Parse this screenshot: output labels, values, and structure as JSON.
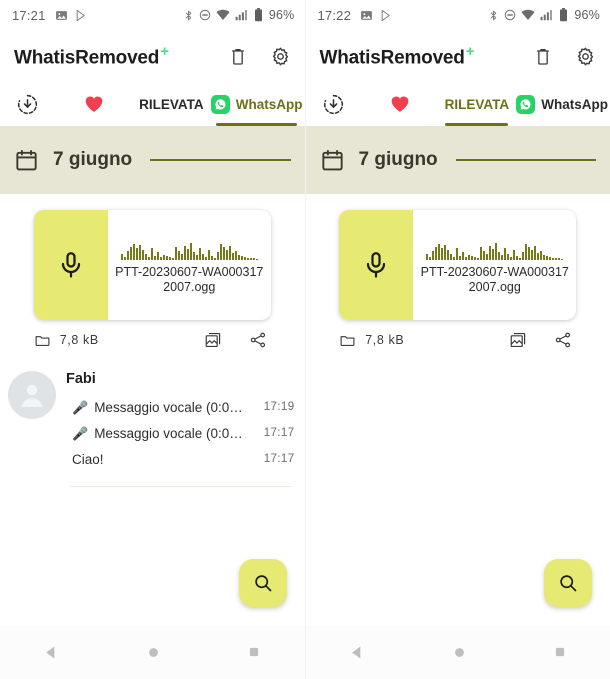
{
  "panels": [
    {
      "status": {
        "time": "17:21",
        "battery": "96%",
        "icons": [
          "image-icon",
          "play-store-icon",
          "bluetooth-icon",
          "dnd-icon",
          "wifi-icon",
          "signal-icon",
          "battery-icon"
        ]
      },
      "appbar": {
        "title": "WhatisRemoved",
        "plus": "+",
        "actions": [
          "delete-icon",
          "settings-icon"
        ]
      },
      "tabs": [
        {
          "label": "",
          "icon": "restore-icon",
          "active": false
        },
        {
          "label": "",
          "icon": "heart-icon",
          "active": false
        },
        {
          "label": "RILEVATA",
          "icon": "",
          "active": false
        },
        {
          "label": "WhatsApp",
          "icon": "whatsapp-icon",
          "active": true
        }
      ],
      "date": {
        "label": "7 giugno",
        "icon": "calendar-icon"
      },
      "card": {
        "icon": "microphone-icon",
        "filename": "PTT-20230607-WA0003172007.ogg",
        "size": "7,8 kB",
        "size_icon": "folder-icon",
        "actions": [
          "gallery-icon",
          "share-icon"
        ]
      },
      "chat": {
        "visible": true,
        "name": "Fabi",
        "avatar": "person-avatar-icon",
        "messages": [
          {
            "icon": "🎤",
            "text": "Messaggio vocale (0:0…",
            "time": "17:19"
          },
          {
            "icon": "🎤",
            "text": "Messaggio vocale (0:0…",
            "time": "17:17"
          },
          {
            "icon": "",
            "text": "Ciao!",
            "time": "17:17"
          }
        ]
      },
      "fab": {
        "icon": "search-icon"
      },
      "nav": [
        "back-icon",
        "home-icon",
        "recents-icon"
      ]
    },
    {
      "status": {
        "time": "17:22",
        "battery": "96%",
        "icons": [
          "image-icon",
          "play-store-icon",
          "bluetooth-icon",
          "dnd-icon",
          "wifi-icon",
          "signal-icon",
          "battery-icon"
        ]
      },
      "appbar": {
        "title": "WhatisRemoved",
        "plus": "+",
        "actions": [
          "delete-icon",
          "settings-icon"
        ]
      },
      "tabs": [
        {
          "label": "",
          "icon": "restore-icon",
          "active": false
        },
        {
          "label": "",
          "icon": "heart-icon",
          "active": false
        },
        {
          "label": "RILEVATA",
          "icon": "",
          "active": true
        },
        {
          "label": "WhatsApp",
          "icon": "whatsapp-icon",
          "active": false
        }
      ],
      "date": {
        "label": "7 giugno",
        "icon": "calendar-icon"
      },
      "card": {
        "icon": "microphone-icon",
        "filename": "PTT-20230607-WA0003172007.ogg",
        "size": "7,8 kB",
        "size_icon": "folder-icon",
        "actions": [
          "gallery-icon",
          "share-icon"
        ]
      },
      "chat": {
        "visible": false,
        "name": "",
        "avatar": "",
        "messages": []
      },
      "fab": {
        "icon": "search-icon"
      },
      "nav": [
        "back-icon",
        "home-icon",
        "recents-icon"
      ]
    }
  ],
  "waveform": [
    6,
    3,
    9,
    13,
    16,
    12,
    15,
    10,
    6,
    3,
    12,
    4,
    8,
    3,
    5,
    4,
    3,
    2,
    13,
    9,
    6,
    14,
    11,
    17,
    8,
    5,
    12,
    6,
    3,
    10,
    4,
    2,
    8,
    16,
    13,
    10,
    14,
    7,
    9,
    5,
    4,
    3,
    2,
    2,
    2,
    1
  ],
  "colors": {
    "accent_olive": "#6e7016",
    "band_beige": "#e7e5d3",
    "yellow": "#e6e972",
    "whatsapp_green": "#25d366",
    "plus_green": "#4ddb8a",
    "heart_red": "#f0404f"
  }
}
